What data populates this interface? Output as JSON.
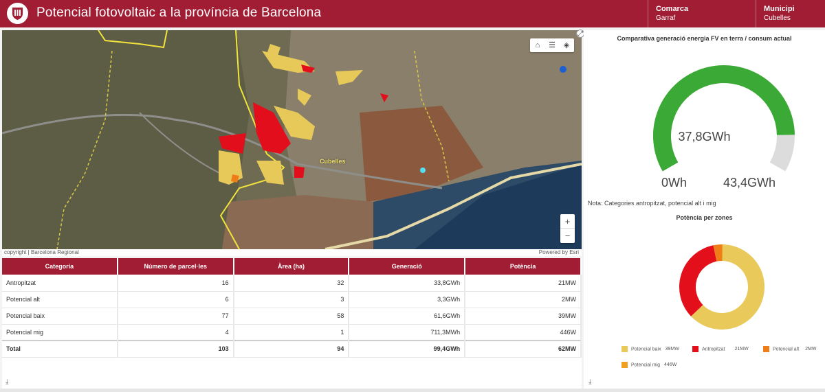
{
  "header": {
    "title": "Potencial fotovoltaic a la província de Barcelona",
    "comarca_label": "Comarca",
    "comarca_value": "Garraf",
    "municipi_label": "Municipi",
    "municipi_value": "Cubelles",
    "accent": "#a01d33"
  },
  "map": {
    "place_label": "Cubelles",
    "attribution_left": "copyright | Barcelona Regional",
    "attribution_right": "Powered by Esri",
    "tools": [
      "home-icon",
      "layer-list-icon",
      "basemap-icon"
    ],
    "zoom_in": "+",
    "zoom_out": "−",
    "expand": "⤢"
  },
  "table": {
    "columns": [
      "Categoria",
      "Número de parcel·les",
      "Àrea (ha)",
      "Generació",
      "Potència"
    ],
    "rows": [
      [
        "Antropitzat",
        "16",
        "32",
        "33,8GWh",
        "21MW"
      ],
      [
        "Potencial alt",
        "6",
        "3",
        "3,3GWh",
        "2MW"
      ],
      [
        "Potencial baix",
        "77",
        "58",
        "61,6GWh",
        "39MW"
      ],
      [
        "Potencial mig",
        "4",
        "1",
        "711,3MWh",
        "446W"
      ]
    ],
    "total": [
      "Total",
      "103",
      "94",
      "99,4GWh",
      "62MW"
    ],
    "download_icon": "⤓"
  },
  "gauge": {
    "title": "Comparativa generació energia FV en terra / consum actual",
    "value_label": "37,8GWh",
    "min_label": "0Wh",
    "max_label": "43,4GWh",
    "value": 37.8,
    "max": 43.4,
    "fill_color": "#3aa935",
    "track_color": "#dcdcdc"
  },
  "note": "Nota: Categories antropitzat, potencial alt i mig",
  "chart_data": {
    "type": "pie",
    "title": "Potència per zones",
    "categories": [
      "Potencial baix",
      "Antropitzat",
      "Potencial alt",
      "Potencial mig"
    ],
    "values": [
      39,
      21,
      2,
      0.000446
    ],
    "value_labels": [
      "39MW",
      "21MW",
      "2MW",
      "446W"
    ],
    "colors": [
      "#e8c95a",
      "#e3101c",
      "#ef7d18",
      "#f0a01e"
    ],
    "legend": "bottom"
  },
  "right_download_icon": "⤓"
}
